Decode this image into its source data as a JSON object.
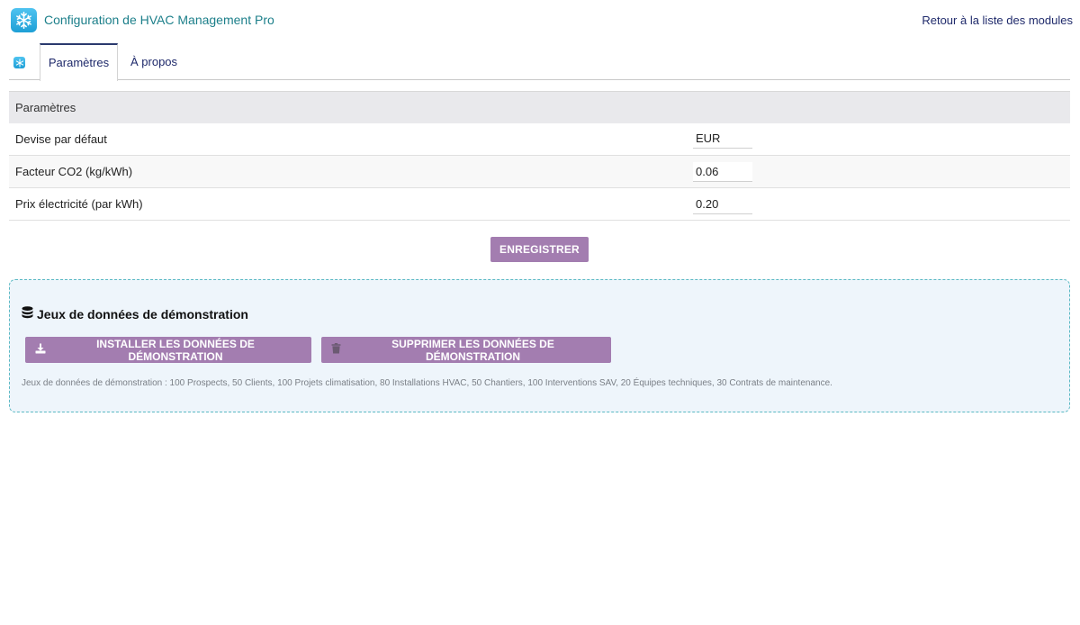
{
  "header": {
    "title": "Configuration de HVAC Management Pro",
    "back_link": "Retour à la liste des modules"
  },
  "tabs": [
    {
      "label": "Paramètres",
      "active": true
    },
    {
      "label": "À propos",
      "active": false
    }
  ],
  "settings": {
    "section_title": "Paramètres",
    "rows": [
      {
        "label": "Devise par défaut",
        "value": "EUR"
      },
      {
        "label": "Facteur CO2 (kg/kWh)",
        "value": "0.06"
      },
      {
        "label": "Prix électricité (par kWh)",
        "value": "0.20"
      }
    ],
    "save_label": "ENREGISTRER"
  },
  "demo": {
    "title": "Jeux de données de démonstration",
    "install_label": "INSTALLER LES DONNÉES DE DÉMONSTRATION",
    "delete_label": "SUPPRIMER LES DONNÉES DE DÉMONSTRATION",
    "description": "Jeux de données de démonstration : 100 Prospects, 50 Clients, 100 Projets climatisation, 80 Installations HVAC, 50 Chantiers, 100 Interventions SAV, 20 Équipes techniques, 30 Contrats de maintenance."
  },
  "icons": {
    "app_logo": "snowflake-icon",
    "tab_icon": "snowflake-icon",
    "demo_title": "database-icon",
    "install": "download-icon",
    "delete": "trash-icon"
  },
  "colors": {
    "accent": "#a37db0",
    "title": "#1c7f8a",
    "link": "#1f2a6b",
    "demo_border": "#5bb9c4",
    "demo_background": "#eef5fb"
  }
}
